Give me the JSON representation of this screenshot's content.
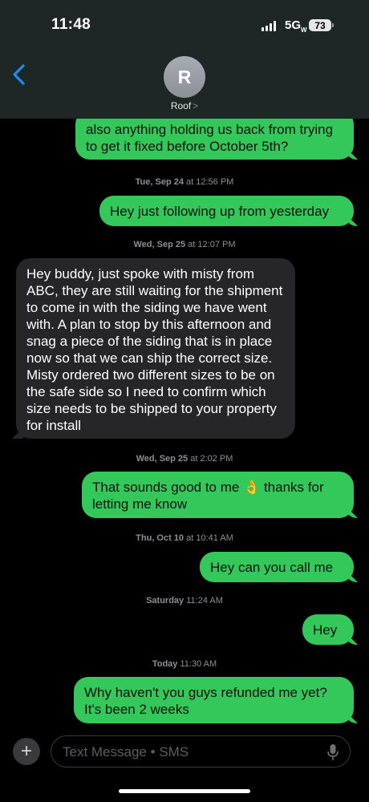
{
  "status": {
    "time": "11:48",
    "network": "5G",
    "network_suffix": "W",
    "battery": "73"
  },
  "header": {
    "avatar_initial": "R",
    "contact_name": "Roof",
    "contact_chevron": ">"
  },
  "messages": [
    {
      "type": "sent",
      "text": "also anything holding us back from trying to get it fixed before October 5th?"
    },
    {
      "type": "timestamp",
      "day": "Tue, Sep 24",
      "time": "12:56 PM"
    },
    {
      "type": "sent",
      "text": "Hey just following up from yesterday"
    },
    {
      "type": "timestamp",
      "day": "Wed, Sep 25",
      "time": "12:07 PM"
    },
    {
      "type": "received",
      "text": "Hey buddy, just spoke with misty from ABC, they are still waiting for the shipment to come in with the siding we have went with. A plan to stop by this afternoon and snag a piece of the siding that is in place now so that we can ship the correct size. Misty ordered two different sizes to be on the safe side so I need to confirm which size needs to be shipped to your property for install"
    },
    {
      "type": "timestamp",
      "day": "Wed, Sep 25",
      "time": "2:02 PM"
    },
    {
      "type": "sent",
      "text": "That sounds good to me 👌 thanks for letting me know"
    },
    {
      "type": "timestamp",
      "day": "Thu, Oct 10",
      "time": "10:41 AM"
    },
    {
      "type": "sent",
      "text": "Hey can you call me"
    },
    {
      "type": "timestamp",
      "day": "Saturday",
      "time": "11:24 AM"
    },
    {
      "type": "sent",
      "text": "Hey"
    },
    {
      "type": "timestamp",
      "day": "Today",
      "time": "11:30 AM"
    },
    {
      "type": "sent",
      "text": "Why haven't you guys refunded me yet? It's been 2 weeks"
    }
  ],
  "input": {
    "placeholder": "Text Message • SMS",
    "plus_label": "+"
  },
  "icons": {
    "back": "chevron-left-icon",
    "mic": "microphone-icon",
    "plus": "plus-icon"
  },
  "colors": {
    "sent_bubble": "#34c759",
    "received_bubble": "#262628",
    "back_accent": "#1e8cf0"
  }
}
